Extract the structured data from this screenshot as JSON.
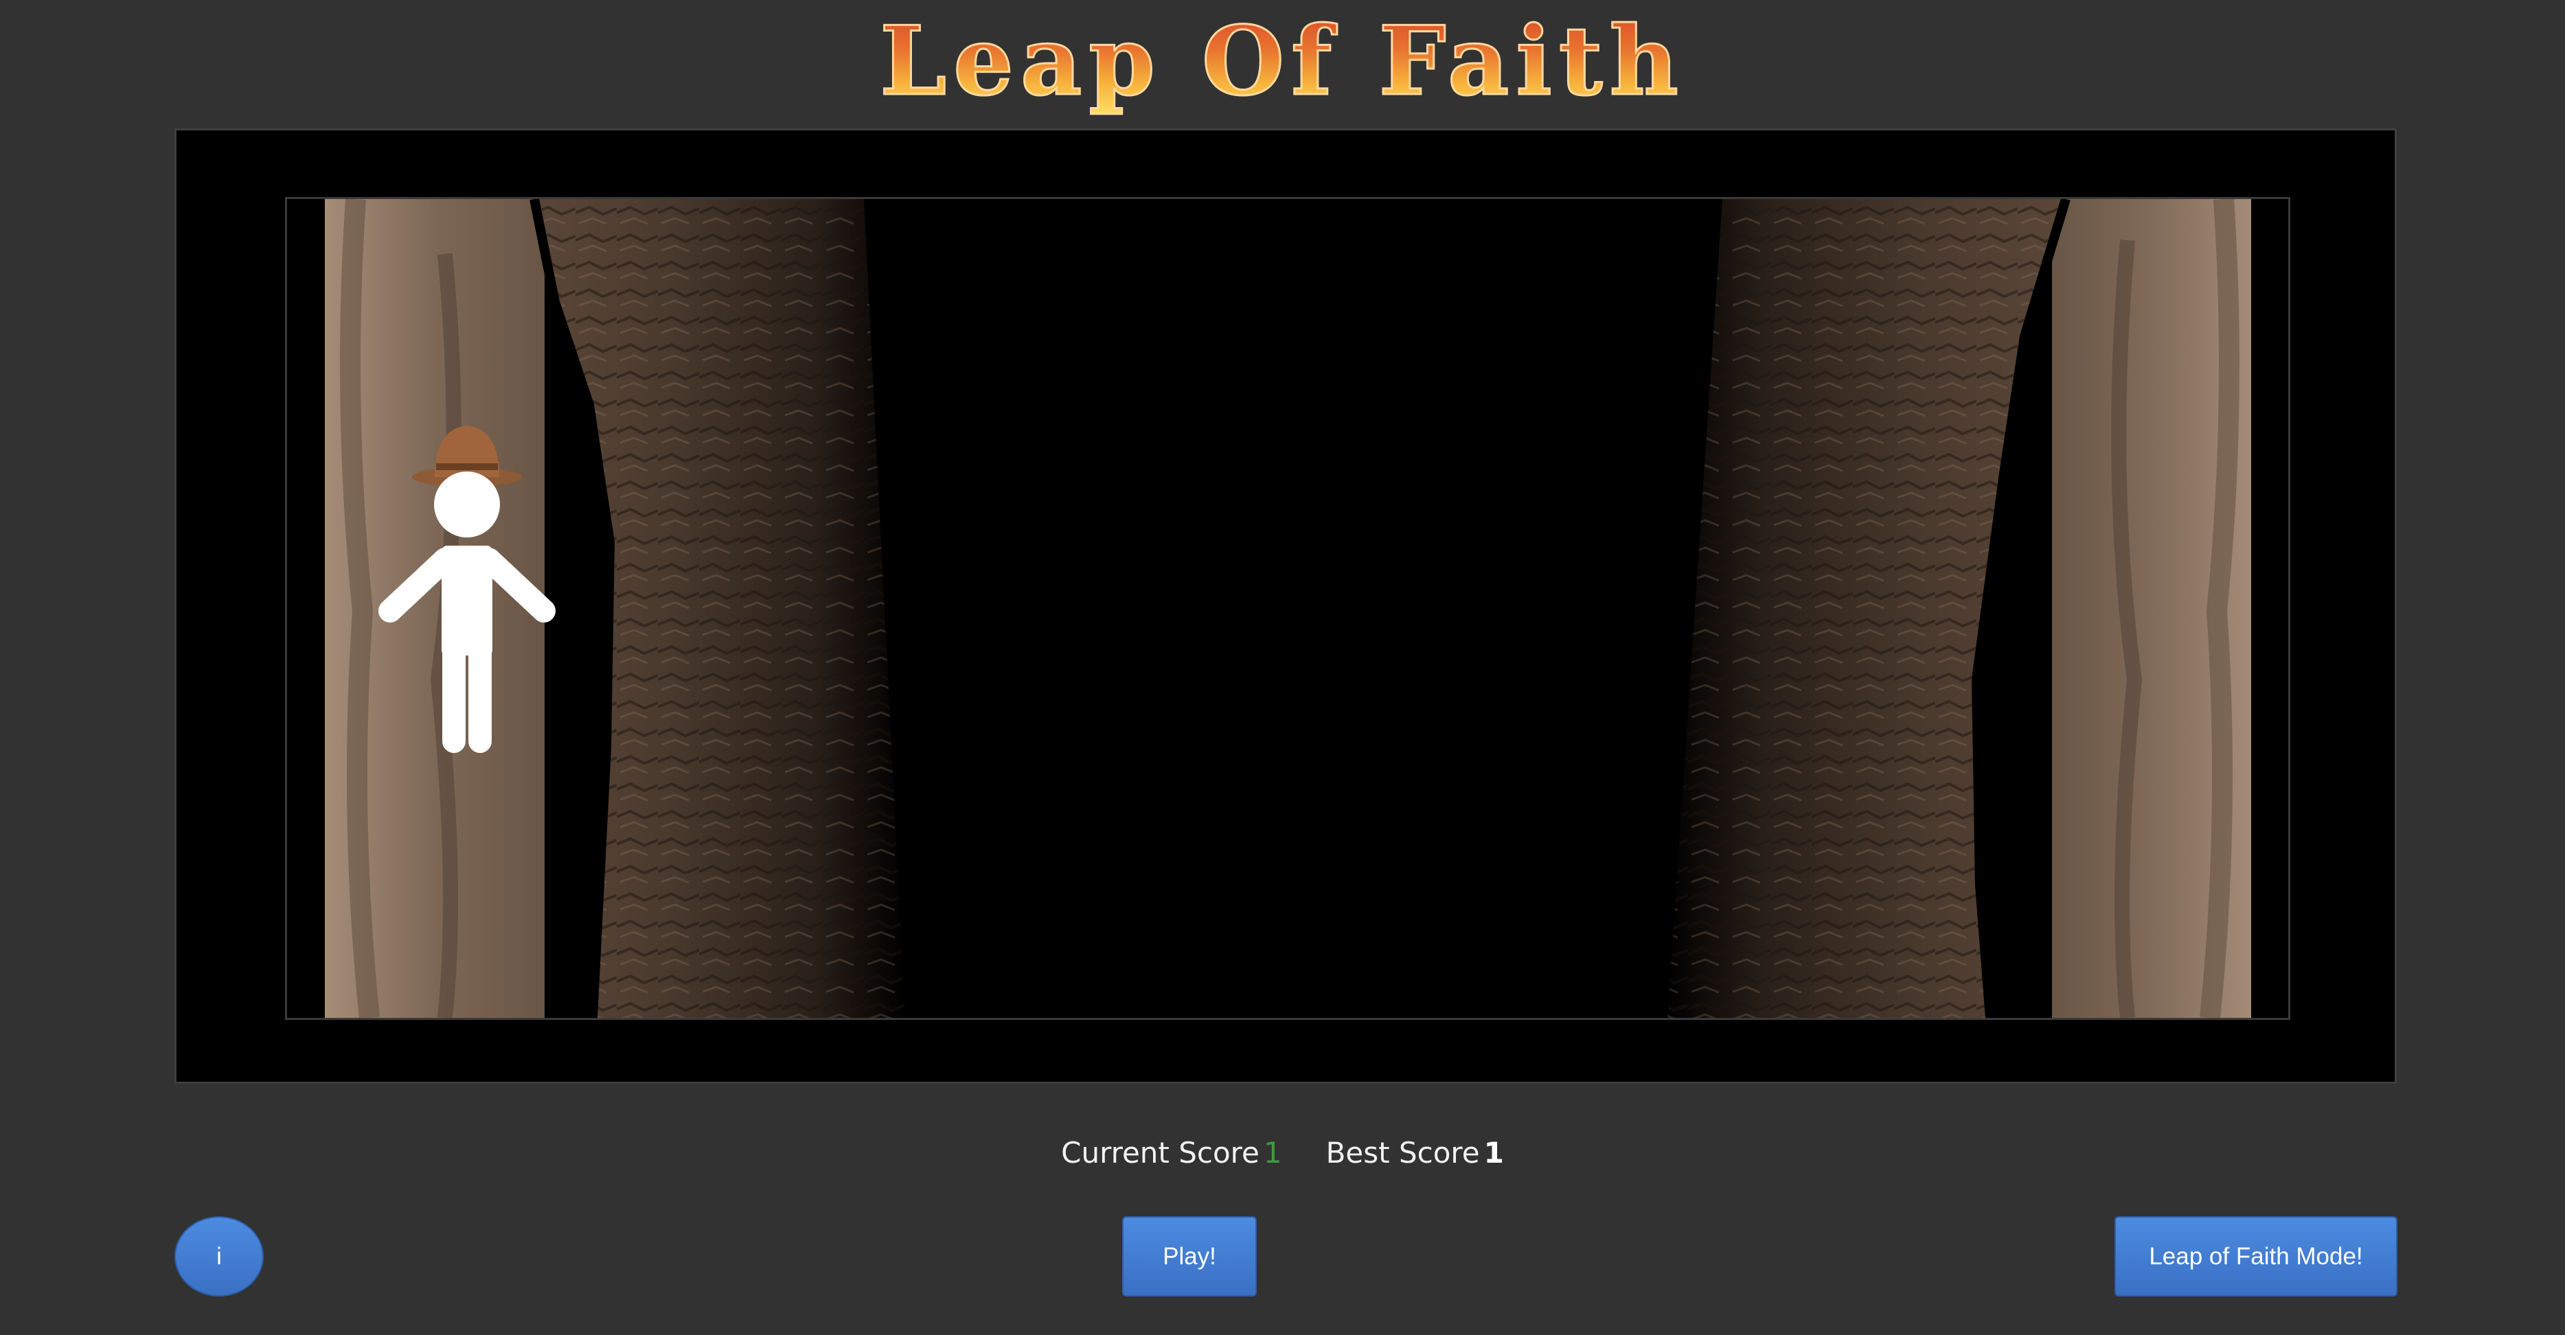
{
  "title": "Leap Of Faith",
  "scores": {
    "current_label": "Current Score",
    "current_value": "1",
    "best_label": "Best Score",
    "best_value": "1"
  },
  "buttons": {
    "info_label": "i",
    "play_label": "Play!",
    "mode_label": "Leap of Faith Mode!"
  },
  "colors": {
    "background": "#323232",
    "button_blue": "#3f7bd1",
    "current_score": "#3f9a3f"
  },
  "scene": {
    "player": "stick-figure-with-fedora",
    "environment": "cliff-chasm"
  }
}
